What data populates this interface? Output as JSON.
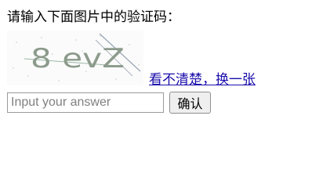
{
  "prompt": {
    "text": "请输入下面图片中的验证码："
  },
  "captcha": {
    "text": "8 evZ"
  },
  "refresh_link": {
    "label": "看不清楚，换一张",
    "color": "#1a0dab"
  },
  "answer_input": {
    "value": "",
    "placeholder": "Input your answer"
  },
  "confirm_button": {
    "label": "确认"
  }
}
